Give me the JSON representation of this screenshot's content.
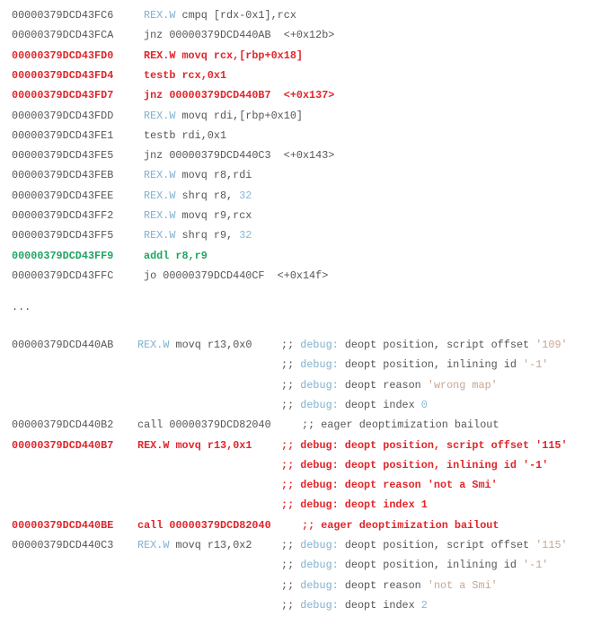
{
  "colors": {
    "default": "#555555",
    "highlight_red": "#e0262b",
    "highlight_green": "#1fa462",
    "keyword": "#7fb0d0",
    "string": "#c7a792",
    "number": "#86b8d8"
  },
  "top_block": [
    {
      "addr": "00000379DCD43FC6",
      "hl": "",
      "ins": [
        {
          "t": "REX.W",
          "c": "kw"
        },
        {
          "t": " cmpq [rdx-0x1],rcx",
          "c": ""
        }
      ]
    },
    {
      "addr": "00000379DCD43FCA",
      "hl": "",
      "ins": [
        {
          "t": "jnz 00000379DCD440AB  <+0x12b>",
          "c": ""
        }
      ]
    },
    {
      "addr": "00000379DCD43FD0",
      "hl": "red",
      "ins": [
        {
          "t": "REX.W movq rcx,[rbp+0x18]",
          "c": ""
        }
      ]
    },
    {
      "addr": "00000379DCD43FD4",
      "hl": "red",
      "ins": [
        {
          "t": "testb rcx,0x1",
          "c": ""
        }
      ]
    },
    {
      "addr": "00000379DCD43FD7",
      "hl": "red",
      "ins": [
        {
          "t": "jnz 00000379DCD440B7  <+0x137>",
          "c": ""
        }
      ]
    },
    {
      "addr": "00000379DCD43FDD",
      "hl": "",
      "ins": [
        {
          "t": "REX.W",
          "c": "kw"
        },
        {
          "t": " movq rdi,[rbp+0x10]",
          "c": ""
        }
      ]
    },
    {
      "addr": "00000379DCD43FE1",
      "hl": "",
      "ins": [
        {
          "t": "testb rdi,0x1",
          "c": ""
        }
      ]
    },
    {
      "addr": "00000379DCD43FE5",
      "hl": "",
      "ins": [
        {
          "t": "jnz 00000379DCD440C3  <+0x143>",
          "c": ""
        }
      ]
    },
    {
      "addr": "00000379DCD43FEB",
      "hl": "",
      "ins": [
        {
          "t": "REX.W",
          "c": "kw"
        },
        {
          "t": " movq r8,rdi",
          "c": ""
        }
      ]
    },
    {
      "addr": "00000379DCD43FEE",
      "hl": "",
      "ins": [
        {
          "t": "REX.W",
          "c": "kw"
        },
        {
          "t": " shrq r8, ",
          "c": ""
        },
        {
          "t": "32",
          "c": "num"
        }
      ]
    },
    {
      "addr": "00000379DCD43FF2",
      "hl": "",
      "ins": [
        {
          "t": "REX.W",
          "c": "kw"
        },
        {
          "t": " movq r9,rcx",
          "c": ""
        }
      ]
    },
    {
      "addr": "00000379DCD43FF5",
      "hl": "",
      "ins": [
        {
          "t": "REX.W",
          "c": "kw"
        },
        {
          "t": " shrq r9, ",
          "c": ""
        },
        {
          "t": "32",
          "c": "num"
        }
      ]
    },
    {
      "addr": "00000379DCD43FF9",
      "hl": "green",
      "ins": [
        {
          "t": "addl r8,r9",
          "c": ""
        }
      ]
    },
    {
      "addr": "00000379DCD43FFC",
      "hl": "",
      "ins": [
        {
          "t": "jo 00000379DCD440CF  <+0x14f>",
          "c": ""
        }
      ]
    }
  ],
  "ellipsis": "...",
  "bottom_block": [
    {
      "addr": "00000379DCD440AB",
      "hl": "",
      "shift": false,
      "ins": [
        {
          "t": "REX.W",
          "c": "kw"
        },
        {
          "t": " movq r13,0x0",
          "c": ""
        }
      ],
      "cmt": [
        {
          "t": ";; ",
          "c": ""
        },
        {
          "t": "debug:",
          "c": "kw"
        },
        {
          "t": " deopt position, script offset ",
          "c": ""
        },
        {
          "t": "'109'",
          "c": "str"
        }
      ]
    },
    {
      "addr": "",
      "hl": "",
      "shift": false,
      "ins": [],
      "cmt": [
        {
          "t": ";; ",
          "c": ""
        },
        {
          "t": "debug:",
          "c": "kw"
        },
        {
          "t": " deopt position, inlining id ",
          "c": ""
        },
        {
          "t": "'-1'",
          "c": "str"
        }
      ]
    },
    {
      "addr": "",
      "hl": "",
      "shift": false,
      "ins": [],
      "cmt": [
        {
          "t": ";; ",
          "c": ""
        },
        {
          "t": "debug:",
          "c": "kw"
        },
        {
          "t": " deopt reason ",
          "c": ""
        },
        {
          "t": "'wrong map'",
          "c": "str"
        }
      ]
    },
    {
      "addr": "",
      "hl": "",
      "shift": false,
      "ins": [],
      "cmt": [
        {
          "t": ";; ",
          "c": ""
        },
        {
          "t": "debug:",
          "c": "kw"
        },
        {
          "t": " deopt index ",
          "c": ""
        },
        {
          "t": "0",
          "c": "num"
        }
      ]
    },
    {
      "addr": "00000379DCD440B2",
      "hl": "",
      "shift": true,
      "ins": [
        {
          "t": "call 00000379DCD82040",
          "c": ""
        }
      ],
      "cmt": [
        {
          "t": ";; eager deoptimization bailout",
          "c": ""
        }
      ]
    },
    {
      "addr": "00000379DCD440B7",
      "hl": "red",
      "shift": false,
      "ins": [
        {
          "t": "REX.W movq r13,0x1",
          "c": ""
        }
      ],
      "cmt": [
        {
          "t": ";; debug: deopt position, script offset '115'",
          "c": ""
        }
      ]
    },
    {
      "addr": "",
      "hl": "red",
      "shift": false,
      "ins": [],
      "cmt": [
        {
          "t": ";; debug: deopt position, inlining id '-1'",
          "c": ""
        }
      ]
    },
    {
      "addr": "",
      "hl": "red",
      "shift": false,
      "ins": [],
      "cmt": [
        {
          "t": ";; debug: deopt reason 'not a Smi'",
          "c": ""
        }
      ]
    },
    {
      "addr": "",
      "hl": "red",
      "shift": false,
      "ins": [],
      "cmt": [
        {
          "t": ";; debug: deopt index 1",
          "c": ""
        }
      ]
    },
    {
      "addr": "00000379DCD440BE",
      "hl": "red",
      "shift": true,
      "ins": [
        {
          "t": "call 00000379DCD82040",
          "c": ""
        }
      ],
      "cmt": [
        {
          "t": ";; eager deoptimization bailout",
          "c": ""
        }
      ]
    },
    {
      "addr": "00000379DCD440C3",
      "hl": "",
      "shift": false,
      "ins": [
        {
          "t": "REX.W",
          "c": "kw"
        },
        {
          "t": " movq r13,0x2",
          "c": ""
        }
      ],
      "cmt": [
        {
          "t": ";; ",
          "c": ""
        },
        {
          "t": "debug:",
          "c": "kw"
        },
        {
          "t": " deopt position, script offset ",
          "c": ""
        },
        {
          "t": "'115'",
          "c": "str"
        }
      ]
    },
    {
      "addr": "",
      "hl": "",
      "shift": false,
      "ins": [],
      "cmt": [
        {
          "t": ";; ",
          "c": ""
        },
        {
          "t": "debug:",
          "c": "kw"
        },
        {
          "t": " deopt position, inlining id ",
          "c": ""
        },
        {
          "t": "'-1'",
          "c": "str"
        }
      ]
    },
    {
      "addr": "",
      "hl": "",
      "shift": false,
      "ins": [],
      "cmt": [
        {
          "t": ";; ",
          "c": ""
        },
        {
          "t": "debug:",
          "c": "kw"
        },
        {
          "t": " deopt reason ",
          "c": ""
        },
        {
          "t": "'not a Smi'",
          "c": "str"
        }
      ]
    },
    {
      "addr": "",
      "hl": "",
      "shift": false,
      "ins": [],
      "cmt": [
        {
          "t": ";; ",
          "c": ""
        },
        {
          "t": "debug:",
          "c": "kw"
        },
        {
          "t": " deopt index ",
          "c": ""
        },
        {
          "t": "2",
          "c": "num"
        }
      ]
    }
  ]
}
